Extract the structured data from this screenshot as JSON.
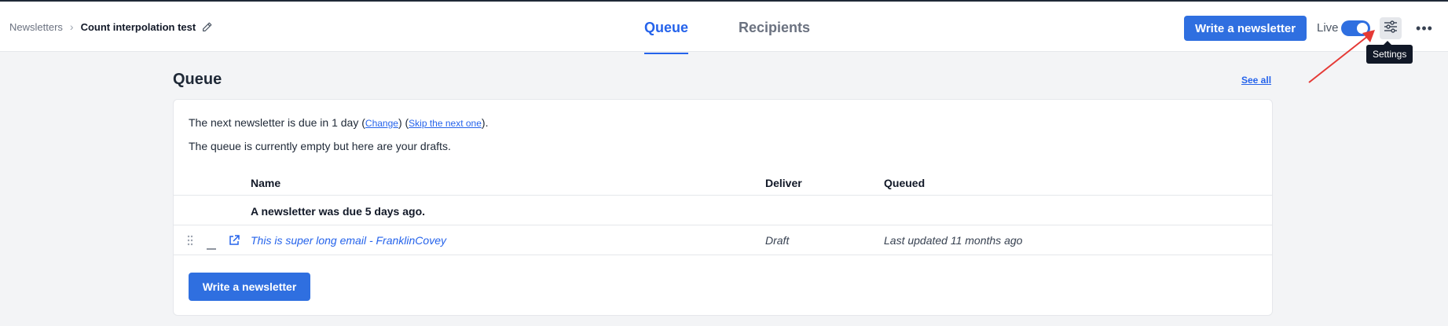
{
  "breadcrumb": {
    "parent": "Newsletters",
    "current": "Count interpolation test"
  },
  "tabs": [
    {
      "label": "Queue",
      "active": true
    },
    {
      "label": "Recipients",
      "active": false
    }
  ],
  "header": {
    "write_button": "Write a newsletter",
    "live_label": "Live",
    "live_enabled": true,
    "settings_tooltip": "Settings",
    "more_icon": "more-horizontal-icon",
    "settings_icon": "sliders-icon"
  },
  "queue": {
    "title": "Queue",
    "see_all": "See all",
    "next_due_prefix": "The next newsletter is due in 1 day (",
    "change_link": "Change",
    "mid_paren": ") (",
    "skip_link": "Skip the next one",
    "next_due_suffix": ").",
    "empty_message": "The queue is currently empty but here are your drafts.",
    "columns": [
      "Name",
      "Deliver",
      "Queued"
    ],
    "due_message": "A newsletter was due 5 days ago.",
    "drafts": [
      {
        "name": "This is super long email - FranklinCovey",
        "deliver": "Draft",
        "queued": "Last updated 11 months ago"
      }
    ],
    "write_button": "Write a newsletter"
  },
  "colors": {
    "accent": "#2f6fe0",
    "link": "#2563eb",
    "arrow": "#e53935"
  }
}
